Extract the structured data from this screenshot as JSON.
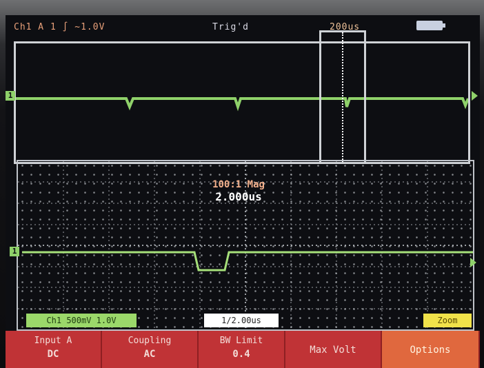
{
  "header": {
    "trigger_info": "Ch1 A 1 ∫ ~1.0V",
    "status": "Trig'd",
    "timebase": "200us"
  },
  "detail": {
    "zoom_ratio": "100:1 Mag",
    "zoom_time": "2.000us"
  },
  "measurements": {
    "left": "Ch1 500mV 1.0V",
    "middle": "1/2.00us",
    "right": "Zoom"
  },
  "softkeys": [
    {
      "label": "Input A",
      "value": "DC"
    },
    {
      "label": "Coupling",
      "value": "AC"
    },
    {
      "label": "BW Limit",
      "value": "0.4"
    },
    {
      "label": "Max Volt",
      "value": ""
    },
    {
      "label": "Options",
      "value": ""
    }
  ],
  "colors": {
    "trace": "#8fd16a",
    "softkey": "#c03336",
    "softkey_active": "#e0683e",
    "frame": "#cfd2d6"
  },
  "icons": {
    "channel_marker": "channel-1-marker-icon",
    "battery": "battery-icon",
    "trigger_arrow": "trigger-level-arrow-icon"
  }
}
